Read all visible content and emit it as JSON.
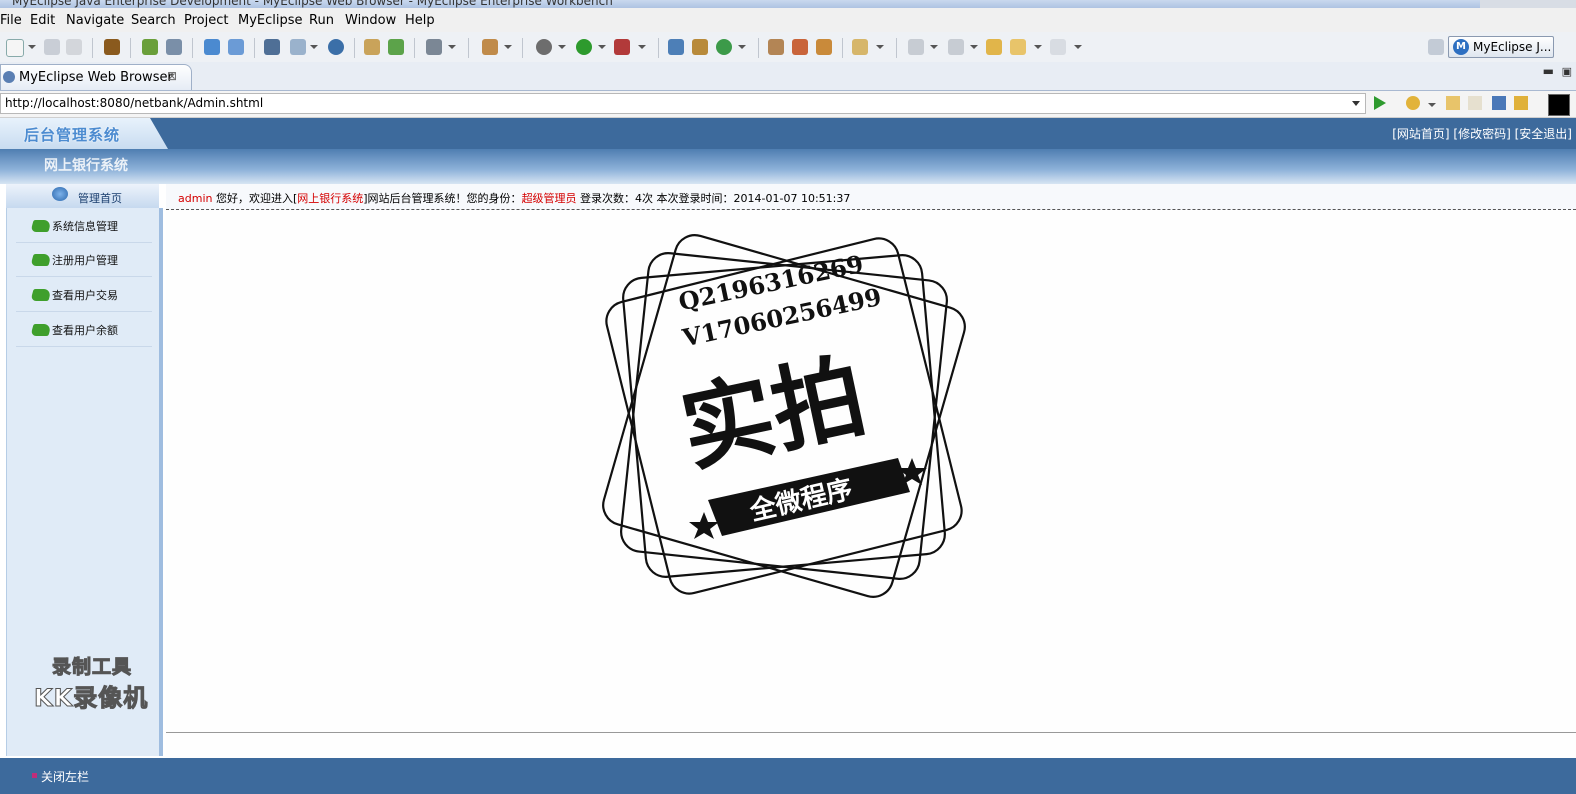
{
  "window": {
    "title": "MyEclipse Java Enterprise Development - MyEclipse Web Browser - MyEclipse Enterprise Workbench"
  },
  "menu": [
    "File",
    "Edit",
    "Navigate",
    "Search",
    "Project",
    "MyEclipse",
    "Run",
    "Window",
    "Help"
  ],
  "toolbar": {
    "perspective_label": "MyEclipse J..."
  },
  "editor_tab": {
    "label": "MyEclipse Web Browser",
    "close": "⊠"
  },
  "browser": {
    "url": "http://localhost:8080/netbank/Admin.shtml"
  },
  "page": {
    "logo": "后台管理系统",
    "subtitle": "网上银行系统",
    "top_links": [
      "[网站首页]",
      "[修改密码]",
      "[安全退出]"
    ],
    "home": "管理首页",
    "sidebar_items": [
      "系统信息管理",
      "注册用户管理",
      "查看用户交易",
      "查看用户余额"
    ],
    "welcome": {
      "user": "admin",
      "greeting": " 您好，欢迎进入[",
      "site": "网上银行系统",
      "suffix": "]网站后台管理系统！您的身份：",
      "role": "超级管理员",
      "login_count": " 登录次数：4次 本次登录时间：2014-01-07 10:51:37"
    },
    "close_sidebar": "关闭左栏"
  },
  "overlay": {
    "stamp_line1": "Q2196316269",
    "stamp_line2": "V17060256499",
    "stamp_main": "实拍",
    "stamp_ribbon": "全微程序",
    "recorder_line1": "录制工具",
    "recorder_line2": "KK录像机"
  }
}
